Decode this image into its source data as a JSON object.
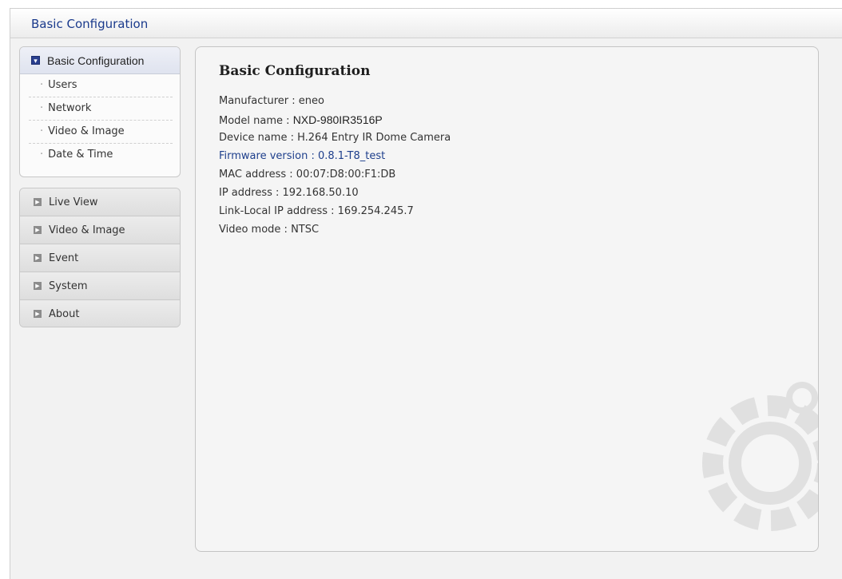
{
  "window": {
    "title": "Basic Configuration"
  },
  "sidebar": {
    "active_section": "Basic Configuration",
    "sub_items": [
      {
        "label": "Users"
      },
      {
        "label": "Network"
      },
      {
        "label": "Video & Image"
      },
      {
        "label": "Date & Time"
      }
    ],
    "sections": [
      {
        "label": "Live View"
      },
      {
        "label": "Video & Image"
      },
      {
        "label": "Event"
      },
      {
        "label": "System"
      },
      {
        "label": "About"
      }
    ]
  },
  "main": {
    "heading": "Basic Configuration",
    "info": {
      "manufacturer": "Manufacturer : eneo",
      "model_label": "Model name :",
      "model_value": "NXD-980IR3516P",
      "device_name": "Device name : H.264 Entry IR Dome Camera",
      "firmware": "Firmware version : 0.8.1-T8_test",
      "mac": "MAC address : 00:07:D8:00:F1:DB",
      "ip": "IP address : 192.168.50.10",
      "link_local": "Link-Local IP address : 169.254.245.7",
      "video_mode": "Video mode : NTSC"
    }
  },
  "colors": {
    "accent": "#1a3a8c",
    "firmware_link": "#1e3f8c"
  }
}
